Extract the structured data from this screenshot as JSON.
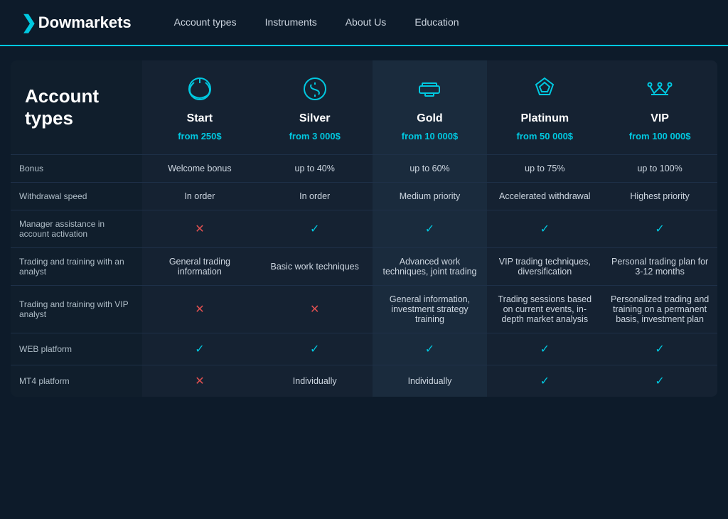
{
  "nav": {
    "logo_prefix": "Dow",
    "logo_suffix": "markets",
    "links": [
      "Account types",
      "Instruments",
      "About Us",
      "Education"
    ]
  },
  "page": {
    "heading_line1": "Account",
    "heading_line2": "types"
  },
  "columns": [
    {
      "id": "start",
      "icon": "power",
      "name": "Start",
      "amount": "from 250$"
    },
    {
      "id": "silver",
      "icon": "dollar",
      "name": "Silver",
      "amount": "from 3 000$"
    },
    {
      "id": "gold",
      "icon": "bars",
      "name": "Gold",
      "amount": "from 10 000$"
    },
    {
      "id": "platinum",
      "icon": "diamond",
      "name": "Platinum",
      "amount": "from 50 000$"
    },
    {
      "id": "vip",
      "icon": "crown",
      "name": "VIP",
      "amount": "from 100 000$"
    }
  ],
  "rows": [
    {
      "label": "Bonus",
      "cells": [
        "Welcome bonus",
        "up to 40%",
        "up to 60%",
        "up to 75%",
        "up to 100%"
      ]
    },
    {
      "label": "Withdrawal speed",
      "cells": [
        "In order",
        "In order",
        "Medium priority",
        "Accelerated withdrawal",
        "Highest priority"
      ]
    },
    {
      "label": "Manager assistance in account activation",
      "cells": [
        "cross",
        "check",
        "check",
        "check",
        "check"
      ]
    },
    {
      "label": "Trading and training with an analyst",
      "cells": [
        "General trading information",
        "Basic work techniques",
        "Advanced work techniques, joint trading",
        "VIP trading techniques, diversification",
        "Personal trading plan for 3-12 months"
      ]
    },
    {
      "label": "Trading and training with VIP analyst",
      "cells": [
        "cross",
        "cross",
        "General information, investment strategy training",
        "Trading sessions based on current events, in-depth market analysis",
        "Personalized trading and training on a permanent basis, investment plan"
      ]
    },
    {
      "label": "WEB platform",
      "cells": [
        "check",
        "check",
        "check",
        "check",
        "check"
      ]
    },
    {
      "label": "MT4 platform",
      "cells": [
        "cross",
        "Individually",
        "Individually",
        "check",
        "check"
      ]
    }
  ]
}
